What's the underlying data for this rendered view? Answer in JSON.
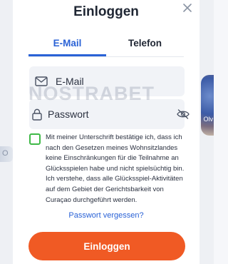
{
  "modal": {
    "title": "Einloggen",
    "close_icon": "close-icon"
  },
  "tabs": [
    {
      "label": "E-Mail",
      "active": true
    },
    {
      "label": "Telefon",
      "active": false
    }
  ],
  "email_field": {
    "placeholder": "E-Mail",
    "value": "",
    "icon": "envelope-icon"
  },
  "password_field": {
    "placeholder": "Passwort",
    "value": "",
    "icon": "lock-icon",
    "toggle_icon": "eye-off-icon"
  },
  "consent": {
    "checked": false,
    "text": "Mit meiner Unterschrift bestätige ich, dass ich nach den Gesetzen meines Wohnsitzlandes keine Einschränkungen für die Teilnahme an Glücksspielen habe und nicht spielsüchtig bin. Ich verstehe, dass alle Glücksspiel-Aktivitäten auf dem Gebiet der Gerichtsbarkeit von Curaçao durchgeführt werden."
  },
  "forgot_password": "Passwort vergessen?",
  "submit_label": "Einloggen",
  "watermark": "NOSTRABET",
  "background": {
    "left_peek": "O",
    "right_peek": "Olv"
  },
  "colors": {
    "accent_blue": "#2a62d6",
    "button_orange": "#f05a24",
    "checkbox_green": "#3fb947",
    "text_dark": "#1f2633",
    "field_bg": "#f1f3f7"
  }
}
